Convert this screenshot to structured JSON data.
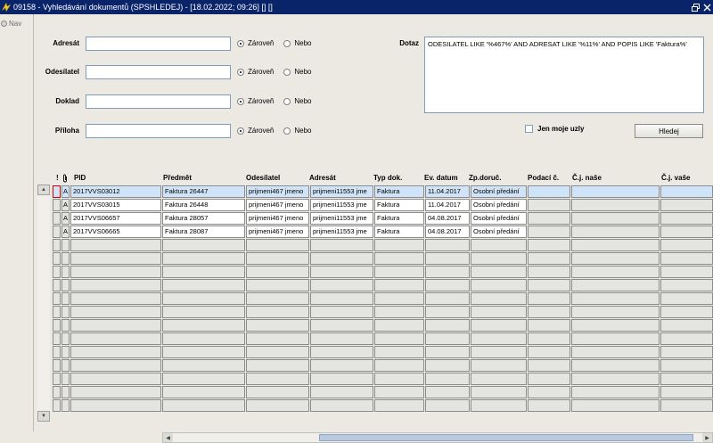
{
  "window": {
    "title": "09158 - Vyhledávání dokumentů (SPSHLEDEJ) - [18.02.2022; 09:26] [] []",
    "restore_icon": "restore-icon",
    "close_icon": "close-icon"
  },
  "nav": {
    "label": "Nav"
  },
  "form": {
    "fields": [
      {
        "label": "Adresát",
        "value": "",
        "radio1": "Zároveň",
        "radio2": "Nebo",
        "selected": "Zároveň"
      },
      {
        "label": "Odesílatel",
        "value": "",
        "radio1": "Zároveň",
        "radio2": "Nebo",
        "selected": "Zároveň"
      },
      {
        "label": "Doklad",
        "value": "",
        "radio1": "Zároveň",
        "radio2": "Nebo",
        "selected": "Zároveň"
      },
      {
        "label": "Příloha",
        "value": "",
        "radio1": "Zároveň",
        "radio2": "Nebo",
        "selected": "Zároveň"
      }
    ],
    "query_label": "Dotaz",
    "query_value": "ODESILATEL LIKE '%467%' AND ADRESAT LIKE '%11%' AND POPIS LIKE 'Faktura%'",
    "checkbox_label": "Jen moje uzly",
    "checkbox_checked": false,
    "search_button": "Hledej"
  },
  "grid": {
    "columns": [
      "!",
      "PID",
      "Předmět",
      "Odesílatel",
      "Adresát",
      "Typ dok.",
      "Ev. datum",
      "Zp.doruč.",
      "Podací č.",
      "Č.j. naše",
      "Č.j. vaše"
    ],
    "attachment_icon": "paperclip-icon",
    "rows": [
      [
        "A",
        "2017VVS03012",
        "Faktura 26447",
        "prijmeni467 jmeno",
        "prijmeni11553 jme",
        "Faktura",
        "11.04.2017",
        "Osobní předání",
        "",
        "",
        ""
      ],
      [
        "A",
        "2017VVS03015",
        "Faktura 26448",
        "prijmeni467 jmeno",
        "prijmeni11553 jme",
        "Faktura",
        "11.04.2017",
        "Osobní předání",
        "",
        "",
        ""
      ],
      [
        "A",
        "2017VVS06657",
        "Faktura 28057",
        "prijmeni467 jmeno",
        "prijmeni11553 jme",
        "Faktura",
        "04.08.2017",
        "Osobní předání",
        "",
        "",
        ""
      ],
      [
        "A",
        "2017VVS06665",
        "Faktura 28087",
        "prijmeni467 jmeno",
        "prijmeni11553 jme",
        "Faktura",
        "04.08.2017",
        "Osobní předání",
        "",
        "",
        ""
      ]
    ],
    "selected_row": 0,
    "empty_row_count": 13
  }
}
